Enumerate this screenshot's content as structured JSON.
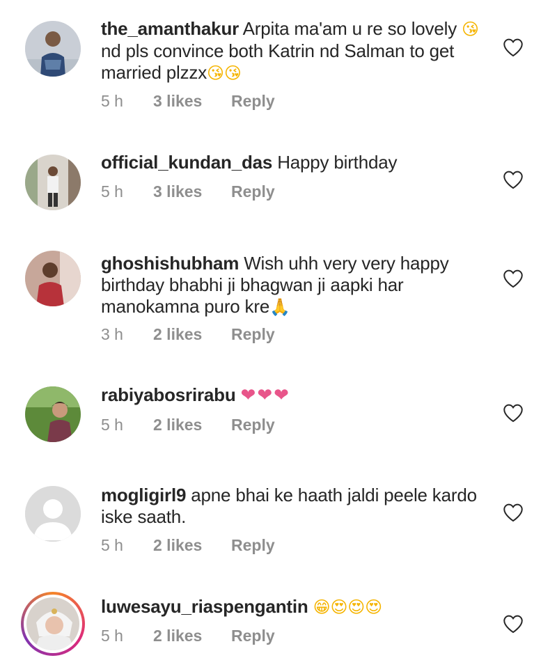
{
  "comments": [
    {
      "username": "the_amanthakur",
      "text_parts": [
        "Arpita ma'am u re so lovely ",
        "😘",
        " nd pls convince both Katrin nd Salman to get married plzzx",
        "😘😘"
      ],
      "time": "5 h",
      "likes": "3 likes",
      "reply": "Reply",
      "avatar": "man-in-sweater"
    },
    {
      "username": "official_kundan_das",
      "text_parts": [
        "Happy birthday"
      ],
      "time": "5 h",
      "likes": "3 likes",
      "reply": "Reply",
      "avatar": "man-outdoors"
    },
    {
      "username": "ghoshishubham",
      "text_parts": [
        "Wish uhh very very happy birthday bhabhi ji bhagwan ji aapki har manokamna puro kre",
        "🙏"
      ],
      "time": "3 h",
      "likes": "2 likes",
      "reply": "Reply",
      "avatar": "man-portrait"
    },
    {
      "username": "rabiyabosrirabu",
      "text_parts": [
        "❤❤❤"
      ],
      "time": "5 h",
      "likes": "2 likes",
      "reply": "Reply",
      "avatar": "woman-garden"
    },
    {
      "username": "mogligirl9",
      "text_parts": [
        "apne bhai ke haath jaldi peele kardo iske saath."
      ],
      "time": "5 h",
      "likes": "2 likes",
      "reply": "Reply",
      "avatar": "default-user"
    },
    {
      "username": "luwesayu_riaspengantin",
      "text_parts": [
        "😁😍😍😍"
      ],
      "time": "5 h",
      "likes": "2 likes",
      "reply": "Reply",
      "avatar": "bride-story"
    }
  ],
  "colors": {
    "text": "#262626",
    "meta": "#8e8e8e",
    "heart_emoji": "#e8558a",
    "icon_outline": "#262626"
  },
  "icons": {
    "like": "heart-outline-icon"
  }
}
